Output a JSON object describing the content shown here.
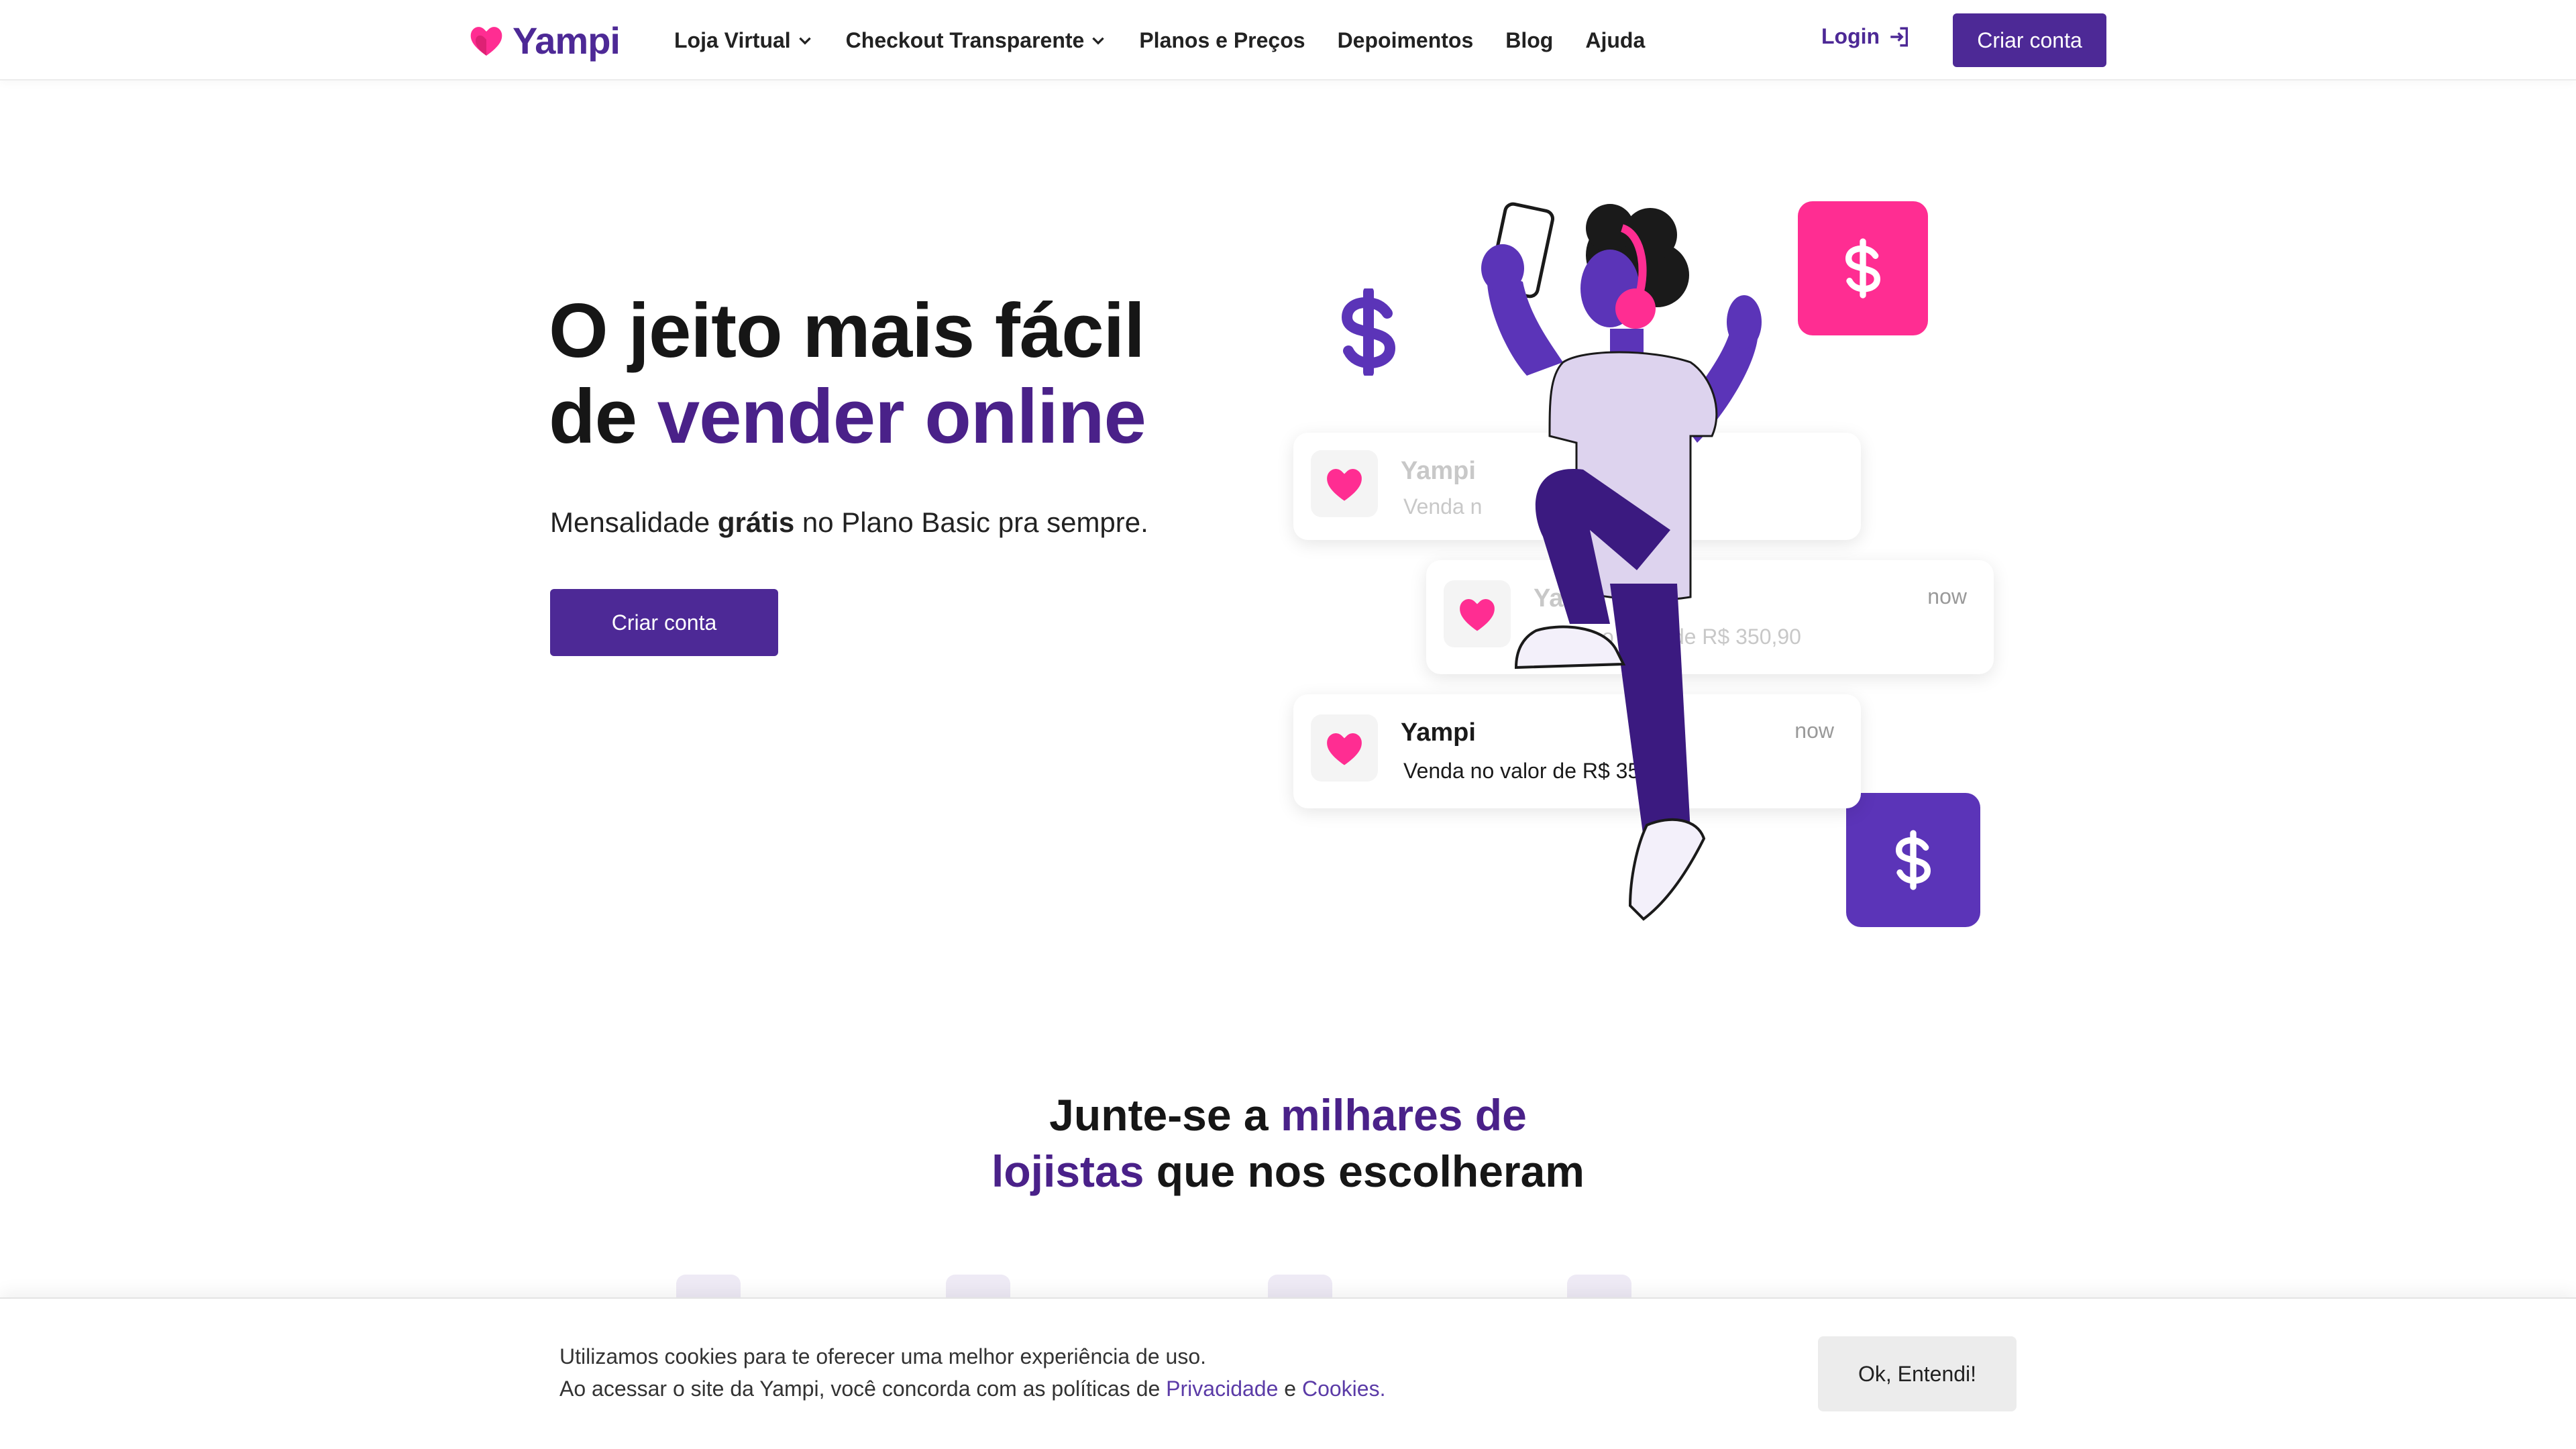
{
  "brand": {
    "name": "Yampi",
    "primary_color": "#4d2996",
    "accent_pink": "#ff2d92"
  },
  "nav": {
    "items": [
      {
        "label": "Loja Virtual",
        "has_dropdown": true
      },
      {
        "label": "Checkout Transparente",
        "has_dropdown": true
      },
      {
        "label": "Planos e Preços",
        "has_dropdown": false
      },
      {
        "label": "Depoimentos",
        "has_dropdown": false
      },
      {
        "label": "Blog",
        "has_dropdown": false
      },
      {
        "label": "Ajuda",
        "has_dropdown": false
      }
    ],
    "login_label": "Login",
    "cta_label": "Criar conta"
  },
  "hero": {
    "title_line1": "O jeito mais fácil",
    "title_line2_prefix": "de ",
    "title_line2_accent": "vender online",
    "subtitle_prefix": "Mensalidade ",
    "subtitle_bold": "grátis",
    "subtitle_suffix": " no Plano Basic pra sempre.",
    "cta_label": "Criar conta"
  },
  "notifications": [
    {
      "title": "Yampi",
      "text": "Venda n",
      "time": "",
      "faded": true
    },
    {
      "title": "Yamp",
      "text": "enda no valor de R$ 350,90",
      "time": "now",
      "faded": true
    },
    {
      "title": "Yampi",
      "text": "Venda no valor de R$ 350,",
      "time": "now",
      "faded": false
    }
  ],
  "join": {
    "prefix": "Junte-se a ",
    "accent_line1": "milhares de",
    "accent_line2": "lojistas",
    "suffix": " que nos escolheram"
  },
  "cookie": {
    "line1": "Utilizamos cookies para te oferecer uma melhor experiência de uso.",
    "line2_prefix": "Ao acessar o site da Yampi, você concorda com as políticas de ",
    "privacy_label": "Privacidade",
    "and": " e ",
    "cookies_label": "Cookies.",
    "button_label": "Ok, Entendi!"
  }
}
